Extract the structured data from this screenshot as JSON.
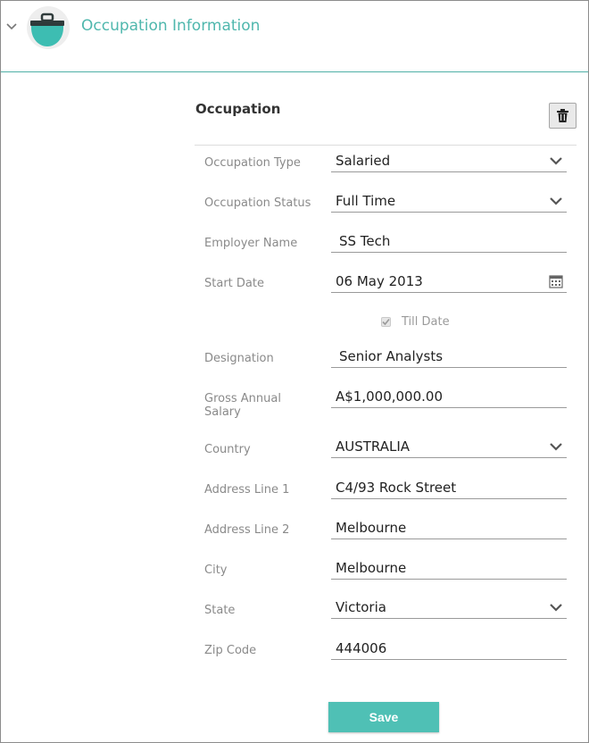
{
  "header": {
    "title": "Occupation Information",
    "icon": "briefcase-icon"
  },
  "section": {
    "title": "Occupation",
    "delete_icon": "trash-icon"
  },
  "fields": {
    "occupation_type": {
      "label": "Occupation Type",
      "value": "Salaried"
    },
    "occupation_status": {
      "label": "Occupation Status",
      "value": "Full Time"
    },
    "employer_name": {
      "label": "Employer Name",
      "value": "SS Tech"
    },
    "start_date": {
      "label": "Start Date",
      "value": "06 May 2013"
    },
    "till_date": {
      "label": "Till Date",
      "checked": true
    },
    "designation": {
      "label": "Designation",
      "value": "Senior Analysts"
    },
    "gross_salary": {
      "label": "Gross Annual Salary",
      "value": "A$1,000,000.00"
    },
    "country": {
      "label": "Country",
      "value": "AUSTRALIA"
    },
    "address1": {
      "label": "Address Line 1",
      "value": "C4/93 Rock Street"
    },
    "address2": {
      "label": "Address Line 2",
      "value": "Melbourne"
    },
    "city": {
      "label": "City",
      "value": "Melbourne"
    },
    "state": {
      "label": "State",
      "value": "Victoria"
    },
    "zip": {
      "label": "Zip Code",
      "value": "444006"
    }
  },
  "save_label": "Save",
  "colors": {
    "accent": "#4fb7ad",
    "button": "#4fc0b5",
    "divider": "#4fb0a6"
  }
}
